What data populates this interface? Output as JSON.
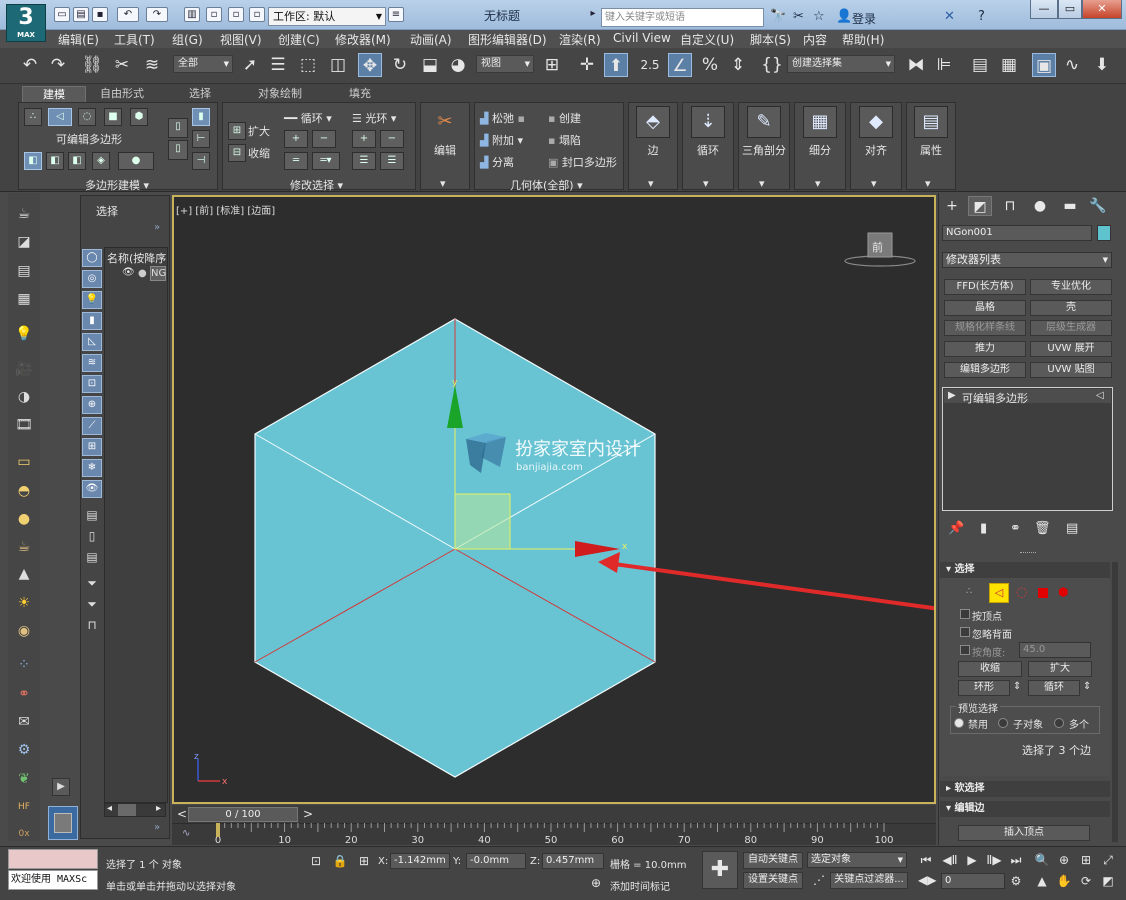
{
  "app": {
    "logo_main": "3",
    "logo_sub": "MAX",
    "title": "无标题",
    "workspace_label": "工作区: 默认",
    "search_placeholder": "键入关键字或短语",
    "login": "登录"
  },
  "menu": [
    "编辑(E)",
    "工具(T)",
    "组(G)",
    "视图(V)",
    "创建(C)",
    "修改器(M)",
    "动画(A)",
    "图形编辑器(D)",
    "渲染(R)",
    "Civil View",
    "自定义(U)",
    "脚本(S)",
    "内容",
    "帮助(H)"
  ],
  "toolbar": {
    "filter_value": "全部",
    "coord_value": "视图",
    "snap_value": "2.5",
    "selection_set": "创建选择集"
  },
  "ribbon": {
    "tabs": [
      "建模",
      "自由形式",
      "选择",
      "对象绘制",
      "填充"
    ],
    "active_tab": "建模",
    "editable_poly": "可编辑多边形",
    "panel_polymodel": "多边形建模",
    "expand": "扩大",
    "shrink": "收缩",
    "loop": "循环",
    "ring": "光环",
    "panel_modsel": "修改选择",
    "edit": "编辑",
    "relax": "松弛",
    "create": "创建",
    "attach": "附加",
    "collapse": "塌陷",
    "detach": "分离",
    "cap_poly": "封口多边形",
    "panel_geometry": "几何体(全部)",
    "big_buttons": [
      "边",
      "循环",
      "三角剖分",
      "细分",
      "对齐",
      "属性"
    ]
  },
  "scene": {
    "header": "选择",
    "column_name": "名称(按降序",
    "item_short": "NG"
  },
  "viewport": {
    "label": "[+] [前] [标准] [边面]",
    "viewcube_label": "前",
    "watermark_cn": "扮家家室内设计",
    "watermark_en": "banjiajia.com",
    "gizmo_x": "x",
    "gizmo_y": "y",
    "axis_x": "x",
    "axis_z": "z"
  },
  "timeline": {
    "frame_display": "0 / 100",
    "ticks": [
      0,
      10,
      20,
      30,
      40,
      50,
      60,
      70,
      80,
      90,
      100
    ],
    "range_max": 100
  },
  "command": {
    "object_name": "NGon001",
    "object_color": "#5fc3cf",
    "modifier_list": "修改器列表",
    "mod_buttons": [
      {
        "label": "FFD(长方体)",
        "dim": false
      },
      {
        "label": "专业优化",
        "dim": false
      },
      {
        "label": "晶格",
        "dim": false
      },
      {
        "label": "壳",
        "dim": false
      },
      {
        "label": "规格化样条线",
        "dim": true
      },
      {
        "label": "层级生成器",
        "dim": true
      },
      {
        "label": "推力",
        "dim": false
      },
      {
        "label": "UVW 展开",
        "dim": false
      },
      {
        "label": "编辑多边形",
        "dim": false
      },
      {
        "label": "UVW 贴图",
        "dim": false
      }
    ],
    "stack_item": "可编辑多边形",
    "rollout_select": "选择",
    "by_vertex": "按顶点",
    "ignore_backface": "忽略背面",
    "by_angle": "按角度:",
    "angle_value": "45.0",
    "shrink": "收缩",
    "grow": "扩大",
    "ring": "环形",
    "loop": "循环",
    "preview_selection": "预览选择",
    "preview_off": "禁用",
    "preview_subobj": "子对象",
    "preview_multi": "多个",
    "selected_info": "选择了 3 个边",
    "rollout_soft": "软选择",
    "rollout_edit_edge": "编辑边",
    "insert_vertex": "插入顶点"
  },
  "status": {
    "maxscript": "欢迎使用 MAXSc",
    "selected_msg": "选择了 1 个 对象",
    "hint": "单击或单击并拖动以选择对象",
    "x_label": "X:",
    "x_value": "-1.142mm",
    "y_label": "Y:",
    "y_value": "-0.0mm",
    "z_label": "Z:",
    "z_value": "0.457mm",
    "grid": "栅格 = 10.0mm",
    "add_time_tag": "添加时间标记",
    "auto_key": "自动关键点",
    "set_key": "设置关键点",
    "selected_objects": "选定对象",
    "key_filters": "关键点过滤器...",
    "frame_value": "0"
  },
  "colors": {
    "cube_fill": "#68c4d3",
    "selected_edge": "#d23a3a",
    "arrow": "#e02a2a",
    "viewport_border": "#c8b25a"
  }
}
